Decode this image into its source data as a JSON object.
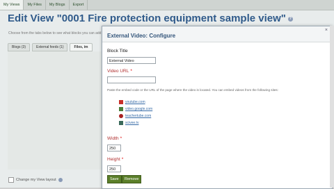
{
  "topnav": {
    "tabs": [
      "My Views",
      "My Files",
      "My Blogs",
      "Export"
    ]
  },
  "page": {
    "title": "Edit View \"0001 Fire protection equipment sample view\"",
    "intro": "Choose from the tabs below to see what blocks you can add",
    "tabs": [
      "Blogs (3)",
      "External feeds (1)",
      "Files, im"
    ],
    "layout_link": "Change my View layout"
  },
  "modal": {
    "title": "External Video: Configure",
    "close": "×",
    "block_title_label": "Block Title",
    "block_title_value": "External Video",
    "video_url_label": "Video URL",
    "video_url_value": "",
    "hint": "Paste the embed code or the URL of the page where the video is located. You can embed videos from the following sites:",
    "sites": [
      "youtube.com",
      "video.google.com",
      "teachertube.com",
      "scivee.tv"
    ],
    "width_label": "Width",
    "width_value": "250",
    "height_label": "Height",
    "height_value": "250",
    "save_label": "Save",
    "remove_label": "Remove",
    "required_marker": "*"
  },
  "colors": {
    "accent": "#2f5a8a",
    "button": "#5b7f2a",
    "required": "#b03030"
  }
}
